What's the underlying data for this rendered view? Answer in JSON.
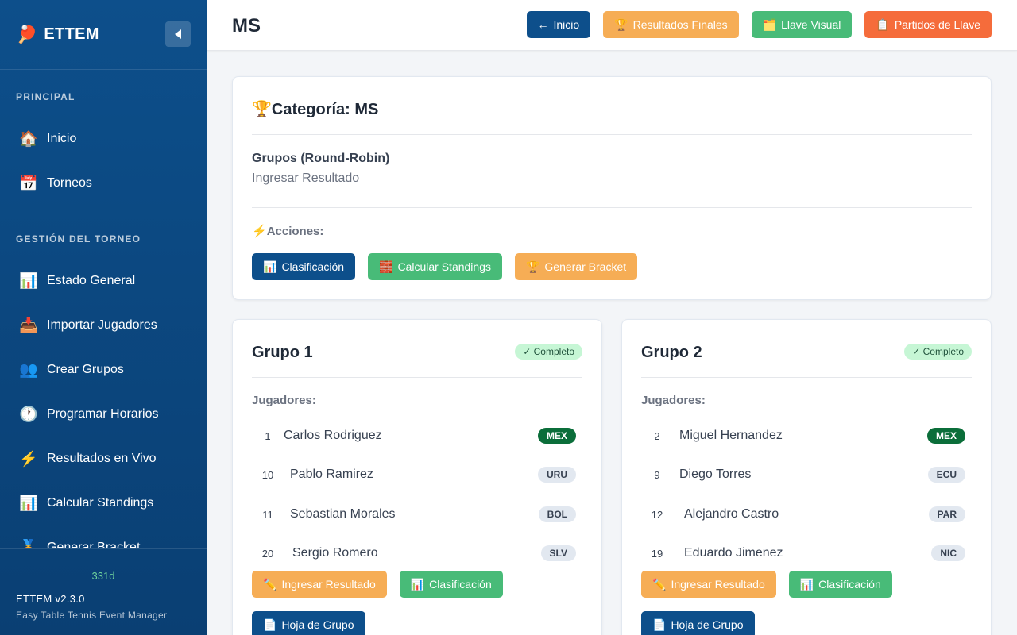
{
  "brand": {
    "logo_icon": "🏓",
    "name": "ETTEM"
  },
  "nav": {
    "sections": [
      {
        "title": "PRINCIPAL",
        "items": [
          {
            "icon": "🏠",
            "label": "Inicio"
          },
          {
            "icon": "📅",
            "label": "Torneos"
          }
        ]
      },
      {
        "title": "GESTIÓN DEL TORNEO",
        "items": [
          {
            "icon": "📊",
            "label": "Estado General"
          },
          {
            "icon": "📥",
            "label": "Importar Jugadores"
          },
          {
            "icon": "👥",
            "label": "Crear Grupos"
          },
          {
            "icon": "🕐",
            "label": "Programar Horarios"
          },
          {
            "icon": "⚡",
            "label": "Resultados en Vivo"
          },
          {
            "icon": "📊",
            "label": "Calcular Standings"
          },
          {
            "icon": "🏅",
            "label": "Generar Bracket"
          }
        ]
      }
    ]
  },
  "footer": {
    "days": "331d",
    "version": "ETTEM v2.3.0",
    "subtitle": "Easy Table Tennis Event Manager"
  },
  "header": {
    "title": "MS",
    "buttons": [
      {
        "icon": "←",
        "label": "Inicio",
        "style": "primary"
      },
      {
        "icon": "🏆",
        "label": "Resultados Finales",
        "style": "warning"
      },
      {
        "icon": "🗂️",
        "label": "Llave Visual",
        "style": "success"
      },
      {
        "icon": "📋",
        "label": "Partidos de Llave",
        "style": "danger"
      }
    ]
  },
  "category": {
    "icon": "🏆",
    "title": "Categoría: MS",
    "phase_name": "Grupos (Round-Robin)",
    "phase_sub": "Ingresar Resultado",
    "actions_icon": "⚡",
    "actions_title": "Acciones:",
    "actions": [
      {
        "icon": "📊",
        "label": "Clasificación",
        "style": "primary"
      },
      {
        "icon": "🧱",
        "label": "Calcular Standings",
        "style": "success"
      },
      {
        "icon": "🏆",
        "label": "Generar Bracket",
        "style": "warning"
      }
    ]
  },
  "groups": [
    {
      "title": "Grupo 1",
      "badge": "✓ Completo",
      "players_label": "Jugadores:",
      "players": [
        {
          "seed": "1",
          "name": "Carlos Rodriguez",
          "country": "MEX",
          "highlight": true
        },
        {
          "seed": "10",
          "name": "Pablo Ramirez",
          "country": "URU",
          "highlight": false
        },
        {
          "seed": "11",
          "name": "Sebastian Morales",
          "country": "BOL",
          "highlight": false
        },
        {
          "seed": "20",
          "name": "Sergio Romero",
          "country": "SLV",
          "highlight": false
        }
      ],
      "actions": [
        {
          "icon": "✏️",
          "label": "Ingresar Resultado",
          "style": "warning"
        },
        {
          "icon": "📊",
          "label": "Clasificación",
          "style": "success"
        }
      ],
      "sheet_button": {
        "icon": "📄",
        "label": "Hoja de Grupo"
      }
    },
    {
      "title": "Grupo 2",
      "badge": "✓ Completo",
      "players_label": "Jugadores:",
      "players": [
        {
          "seed": "2",
          "name": "Miguel Hernandez",
          "country": "MEX",
          "highlight": true
        },
        {
          "seed": "9",
          "name": "Diego Torres",
          "country": "ECU",
          "highlight": false
        },
        {
          "seed": "12",
          "name": "Alejandro Castro",
          "country": "PAR",
          "highlight": false
        },
        {
          "seed": "19",
          "name": "Eduardo Jimenez",
          "country": "NIC",
          "highlight": false
        }
      ],
      "actions": [
        {
          "icon": "✏️",
          "label": "Ingresar Resultado",
          "style": "warning"
        },
        {
          "icon": "📊",
          "label": "Clasificación",
          "style": "success"
        }
      ],
      "sheet_button": {
        "icon": "📄",
        "label": "Hoja de Grupo"
      }
    }
  ],
  "colors": {
    "primary": "#0d4f8b",
    "warning": "#f6ad55",
    "success": "#48bb78",
    "danger": "#f56c3b"
  }
}
